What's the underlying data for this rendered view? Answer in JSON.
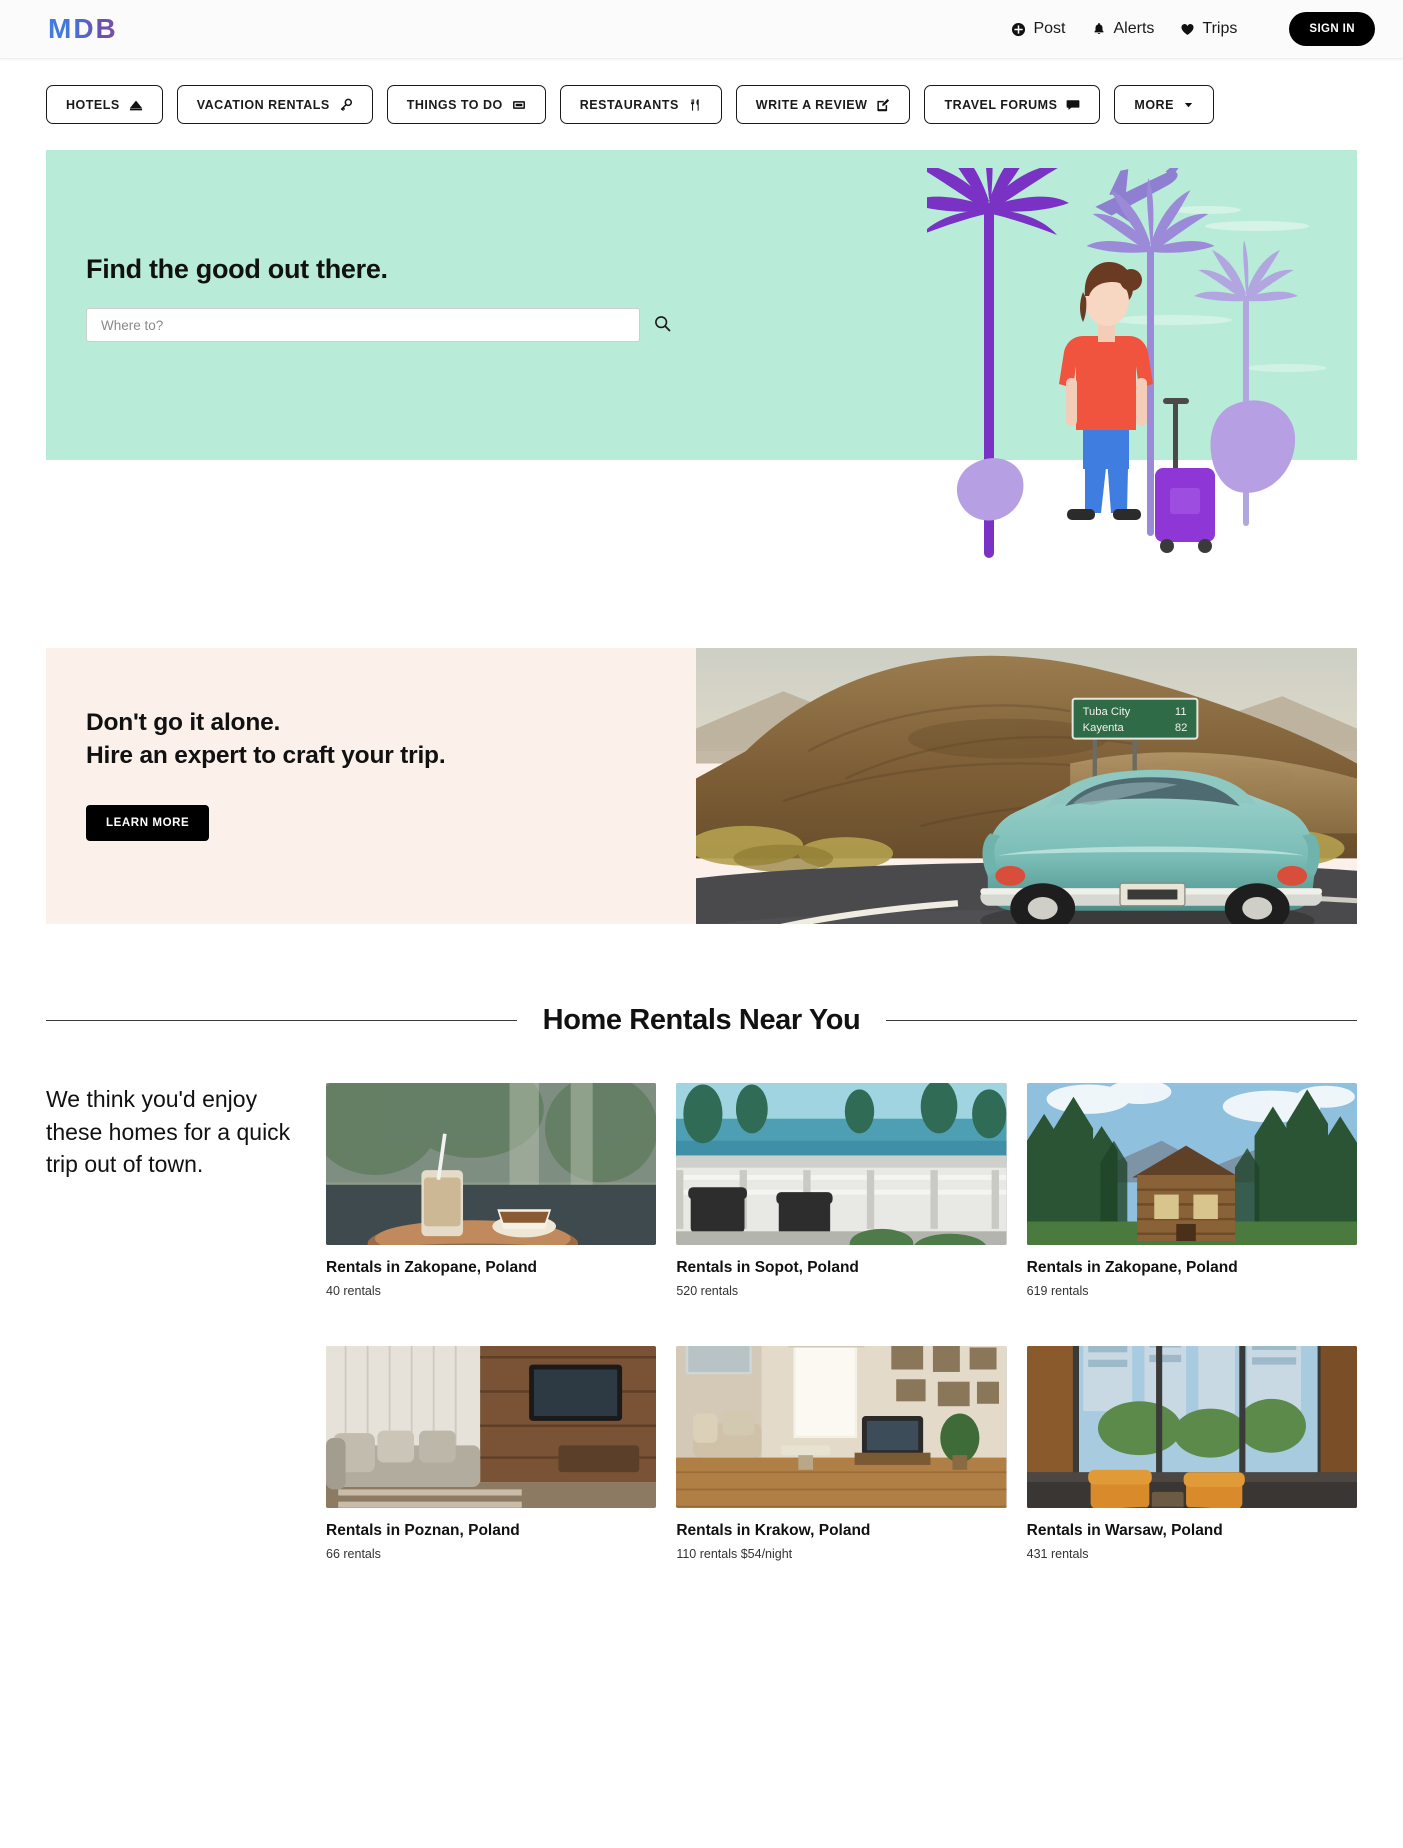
{
  "brand": {
    "logo_text": "MDB"
  },
  "topnav": {
    "items": [
      {
        "label": "Post",
        "icon": "plus-circle-icon"
      },
      {
        "label": "Alerts",
        "icon": "bell-icon"
      },
      {
        "label": "Trips",
        "icon": "heart-icon"
      }
    ],
    "signin_label": "SIGN IN"
  },
  "catnav": {
    "items": [
      {
        "label": "HOTELS",
        "icon": "bed-icon"
      },
      {
        "label": "VACATION RENTALS",
        "icon": "key-icon"
      },
      {
        "label": "THINGS TO DO",
        "icon": "ticket-icon"
      },
      {
        "label": "RESTAURANTS",
        "icon": "cutlery-icon"
      },
      {
        "label": "WRITE A REVIEW",
        "icon": "pencil-square-icon"
      },
      {
        "label": "TRAVEL FORUMS",
        "icon": "comment-icon"
      },
      {
        "label": "MORE",
        "icon": "caret-down-icon"
      }
    ]
  },
  "hero": {
    "title": "Find the good out there.",
    "search_placeholder": "Where to?",
    "search_value": "",
    "background_color": "#b9ecd8",
    "illustration": "traveler-with-palm-trees-illustration"
  },
  "banner": {
    "line1": "Don't go it alone.",
    "line2": "Hire an expert to craft your trip.",
    "button_label": "LEARN MORE",
    "background_color": "#fbf1ea",
    "photo": "vintage-car-on-desert-road-photo",
    "road_sign": {
      "line1_place": "Tuba City",
      "line1_dist": "11",
      "line2_place": "Kayenta",
      "line2_dist": "82"
    }
  },
  "section": {
    "title": "Home Rentals Near You",
    "intro": "We think you'd enjoy these homes for a quick trip out of town."
  },
  "rentals": [
    {
      "title": "Rentals in Zakopane, Poland",
      "sub": "40 rentals",
      "image": "cafe-drink-on-table-photo"
    },
    {
      "title": "Rentals in Sopot, Poland",
      "sub": "520 rentals",
      "image": "seaside-terrace-photo"
    },
    {
      "title": "Rentals in Zakopane, Poland",
      "sub": "619 rentals",
      "image": "wooden-cabin-in-forest-photo"
    },
    {
      "title": "Rentals in Poznan, Poland",
      "sub": "66 rentals",
      "image": "modern-living-room-photo"
    },
    {
      "title": "Rentals in Krakow, Poland",
      "sub": "110 rentals $54/night",
      "image": "classic-apartment-interior-photo"
    },
    {
      "title": "Rentals in Warsaw, Poland",
      "sub": "431 rentals",
      "image": "city-view-lounge-photo"
    }
  ]
}
